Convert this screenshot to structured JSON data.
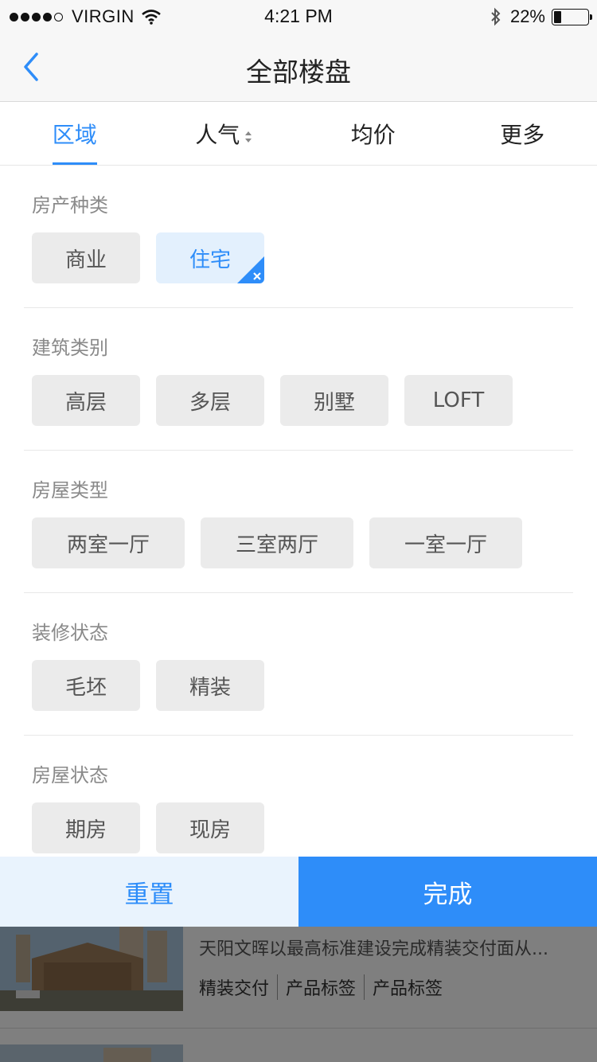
{
  "status_bar": {
    "carrier": "VIRGIN",
    "time": "4:21 PM",
    "battery_percent": "22%",
    "battery_level": 0.22,
    "signal_icons": [
      "signal-dots-icon",
      "wifi-icon",
      "bluetooth-icon",
      "battery-icon"
    ]
  },
  "nav": {
    "title": "全部楼盘",
    "back_icon": "chevron-left-icon"
  },
  "tabs": [
    {
      "label": "区域",
      "active": true
    },
    {
      "label": "人气",
      "active": false,
      "icon": "sort-icon"
    },
    {
      "label": "均价",
      "active": false
    },
    {
      "label": "更多",
      "active": false
    }
  ],
  "filters": [
    {
      "title": "房产种类",
      "options": [
        "商业",
        "住宅"
      ],
      "selected": "住宅"
    },
    {
      "title": "建筑类别",
      "options": [
        "高层",
        "多层",
        "别墅",
        "LOFT"
      ]
    },
    {
      "title": "房屋类型",
      "options": [
        "两室一厅",
        "三室两厅",
        "一室一厅"
      ]
    },
    {
      "title": "装修状态",
      "options": [
        "毛坯",
        "精装"
      ]
    },
    {
      "title": "房屋状态",
      "options": [
        "期房",
        "现房"
      ]
    }
  ],
  "actions": {
    "reset_label": "重置",
    "done_label": "完成"
  },
  "background_list": {
    "item_description": "天阳文晖以最高标准建设完成精装交付面从...",
    "item_tags": [
      "精装交付",
      "产品标签",
      "产品标签"
    ]
  },
  "colors": {
    "accent": "#2e8df9",
    "chip_bg": "#ebebeb",
    "selected_chip_bg": "#e3f0fd",
    "reset_bg": "#e9f3fd"
  }
}
